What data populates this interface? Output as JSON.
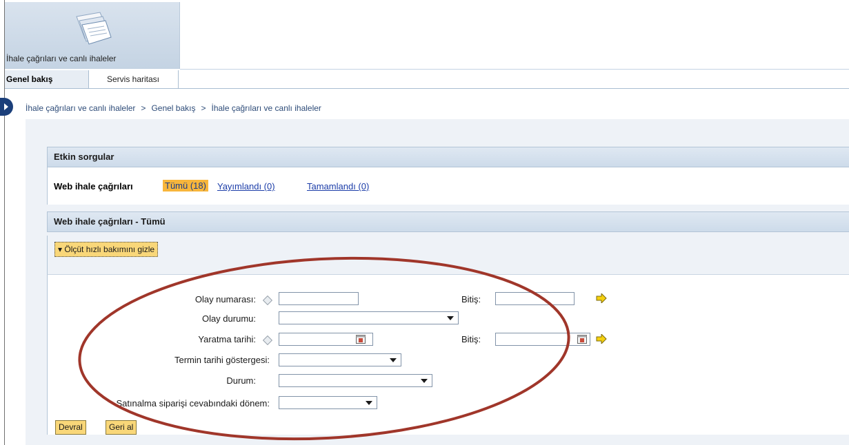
{
  "app": {
    "tile_title": "İhale çağrıları ve canlı ihaleler"
  },
  "tabs": [
    {
      "label": "Genel bakış",
      "active": true
    },
    {
      "label": "Servis haritası",
      "active": false
    }
  ],
  "breadcrumb": [
    "İhale çağrıları ve canlı ihaleler",
    "Genel bakış",
    "İhale çağrıları ve canlı ihaleler"
  ],
  "breadcrumb_sep": ">",
  "active_queries": {
    "header": "Etkin sorgular",
    "label": "Web ihale çağrıları",
    "selected": "Tümü (18)",
    "links": [
      "Yayımlandı (0)",
      "Tamamlandı (0)"
    ]
  },
  "result_panel": {
    "header": "Web ihale çağrıları - Tümü",
    "toggle_label": "Ölçüt hızlı bakımını gizle"
  },
  "form": {
    "event_number_label": "Olay numarası:",
    "event_status_label": "Olay durumu:",
    "creation_date_label": "Yaratma tarihi:",
    "deadline_indicator_label": "Termin tarihi göstergesi:",
    "status_label": "Durum:",
    "po_response_period_label": "Satınalma siparişi cevabındaki dönem:",
    "to_label": "Bitiş:",
    "event_number_value": "",
    "event_number_to_value": "",
    "creation_date_value": "",
    "creation_date_to_value": "",
    "event_status_value": "",
    "deadline_indicator_value": "",
    "status_value": "",
    "po_response_period_value": ""
  },
  "buttons": {
    "apply": "Devral",
    "reset": "Geri al"
  },
  "colors": {
    "highlight": "#f8b63b",
    "button": "#f9d779",
    "annotation_ellipse": "#a0362a",
    "link": "#1a3ca8"
  },
  "icons": [
    "document-stack-icon",
    "nav-arrow-icon",
    "calendar-icon",
    "yellow-arrow-icon",
    "diamond-icon"
  ]
}
